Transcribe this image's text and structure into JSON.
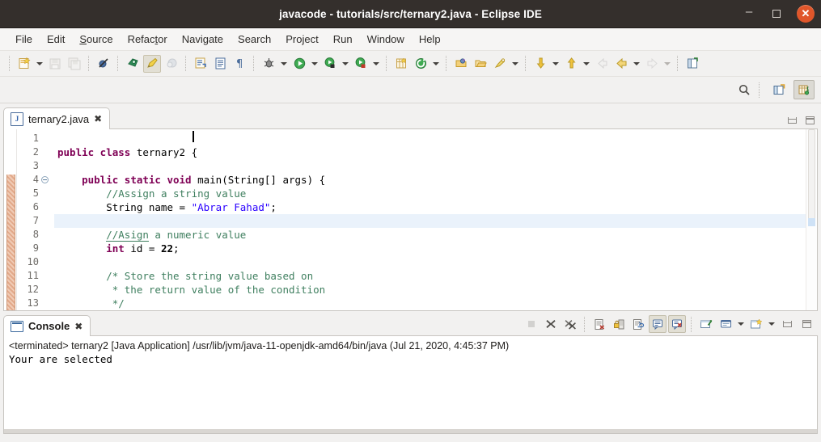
{
  "window": {
    "title": "javacode - tutorials/src/ternary2.java - Eclipse IDE",
    "minimize_label": "–",
    "maximize_label": "",
    "close_label": "✕"
  },
  "menubar": {
    "items": [
      {
        "label": "File",
        "mnemonic": ""
      },
      {
        "label": "Edit",
        "mnemonic": ""
      },
      {
        "label": "Source",
        "mnemonic": "S"
      },
      {
        "label": "Refactor",
        "mnemonic": "t"
      },
      {
        "label": "Navigate",
        "mnemonic": ""
      },
      {
        "label": "Search",
        "mnemonic": ""
      },
      {
        "label": "Project",
        "mnemonic": ""
      },
      {
        "label": "Run",
        "mnemonic": ""
      },
      {
        "label": "Window",
        "mnemonic": ""
      },
      {
        "label": "Help",
        "mnemonic": ""
      }
    ]
  },
  "toolbar": {
    "items": [
      {
        "name": "new-wizard",
        "tooltip": "New"
      },
      {
        "name": "new-dropdown",
        "tooltip": "New menu"
      },
      {
        "name": "save",
        "tooltip": "Save",
        "disabled": true
      },
      {
        "name": "save-all",
        "tooltip": "Save All",
        "disabled": true
      },
      {
        "name": "link-with-editor",
        "tooltip": "Toggle Mark Occurrences"
      },
      {
        "name": "skip-breakpoints",
        "tooltip": "Skip All Breakpoints"
      },
      {
        "name": "toggle-mark-occurrences",
        "tooltip": "Toggle Mark Occurrences",
        "pressed": true
      },
      {
        "name": "coverage",
        "tooltip": "Coverage",
        "disabled": true
      },
      {
        "name": "new-java-class",
        "tooltip": "New Java Class"
      },
      {
        "name": "open-type",
        "tooltip": "Open Type"
      },
      {
        "name": "toggle-whitespace",
        "tooltip": "Show Whitespace Characters"
      },
      {
        "name": "debug",
        "tooltip": "Debug"
      },
      {
        "name": "debug-dropdown",
        "tooltip": "Debug menu"
      },
      {
        "name": "run",
        "tooltip": "Run"
      },
      {
        "name": "run-dropdown",
        "tooltip": "Run menu"
      },
      {
        "name": "coverage-run",
        "tooltip": "Coverage As"
      },
      {
        "name": "coverage-dropdown",
        "tooltip": "Coverage menu"
      },
      {
        "name": "external-tools",
        "tooltip": "External Tools"
      },
      {
        "name": "external-tools-dropdown",
        "tooltip": "External Tools menu"
      },
      {
        "name": "new-java-project",
        "tooltip": "New Java Project"
      },
      {
        "name": "search-type",
        "tooltip": "Search"
      },
      {
        "name": "search-dropdown",
        "tooltip": "Search menu"
      },
      {
        "name": "open-package",
        "tooltip": "Open Task"
      },
      {
        "name": "open-folder",
        "tooltip": "Open Resource"
      },
      {
        "name": "quick-fix",
        "tooltip": "Quick Access"
      },
      {
        "name": "quick-fix-dropdown",
        "tooltip": "Quick Access menu"
      },
      {
        "name": "previous-annotation",
        "tooltip": "Previous Annotation"
      },
      {
        "name": "previous-dropdown",
        "tooltip": "Previous menu"
      },
      {
        "name": "next-annotation",
        "tooltip": "Next Annotation"
      },
      {
        "name": "next-dropdown",
        "tooltip": "Next menu"
      },
      {
        "name": "back",
        "tooltip": "Back",
        "disabled": true
      },
      {
        "name": "back-history",
        "tooltip": "Back History"
      },
      {
        "name": "back-history-dropdown",
        "tooltip": "Back History menu"
      },
      {
        "name": "forward",
        "tooltip": "Forward",
        "disabled": true
      },
      {
        "name": "forward-dropdown",
        "tooltip": "Forward menu",
        "disabled": true
      },
      {
        "name": "open-perspective-last",
        "tooltip": "Open Perspective"
      }
    ]
  },
  "toolbar2": {
    "quick_access_icon": "search-icon",
    "open_perspective_icon": "open-perspective-icon",
    "active_perspective": "Java",
    "active_perspective_icon": "java-perspective-icon"
  },
  "editor": {
    "tab": {
      "label": "ternary2.java",
      "icon": "java-file-icon",
      "close_label": "✖"
    },
    "minimize_tooltip": "Minimize",
    "maximize_tooltip": "Maximize",
    "lines": [
      {
        "num": "1",
        "tokens": []
      },
      {
        "num": "2",
        "tokens": [
          {
            "t": "public class",
            "c": "kw"
          },
          {
            "t": " ternary2 {",
            "c": "plain"
          }
        ]
      },
      {
        "num": "3",
        "tokens": []
      },
      {
        "num": "4",
        "fold": true,
        "tokens": [
          {
            "t": "    ",
            "c": "plain"
          },
          {
            "t": "public static void",
            "c": "kw"
          },
          {
            "t": " main(String[] args) {",
            "c": "plain"
          }
        ]
      },
      {
        "num": "5",
        "tokens": [
          {
            "t": "        ",
            "c": "plain"
          },
          {
            "t": "//Assign a string value",
            "c": "cmt"
          }
        ]
      },
      {
        "num": "6",
        "tokens": [
          {
            "t": "        String name = ",
            "c": "plain"
          },
          {
            "t": "\"Abrar Fahad\"",
            "c": "str"
          },
          {
            "t": ";",
            "c": "plain"
          }
        ]
      },
      {
        "num": "7",
        "current": true,
        "tokens": []
      },
      {
        "num": "8",
        "tokens": [
          {
            "t": "        ",
            "c": "plain"
          },
          {
            "t": "//Asign",
            "c": "typo"
          },
          {
            "t": " a numeric value",
            "c": "cmt"
          }
        ]
      },
      {
        "num": "9",
        "tokens": [
          {
            "t": "        ",
            "c": "plain"
          },
          {
            "t": "int",
            "c": "kw"
          },
          {
            "t": " id = ",
            "c": "plain"
          },
          {
            "t": "22",
            "c": "num"
          },
          {
            "t": ";",
            "c": "plain"
          }
        ]
      },
      {
        "num": "10",
        "tokens": []
      },
      {
        "num": "11",
        "tokens": [
          {
            "t": "        ",
            "c": "plain"
          },
          {
            "t": "/* Store the string value based on",
            "c": "cmt"
          }
        ]
      },
      {
        "num": "12",
        "tokens": [
          {
            "t": "         ",
            "c": "plain"
          },
          {
            "t": "* the return value of the condition",
            "c": "cmt"
          }
        ]
      },
      {
        "num": "13",
        "tokens": [
          {
            "t": "         ",
            "c": "plain"
          },
          {
            "t": "*/",
            "c": "cmt"
          }
        ]
      }
    ]
  },
  "console": {
    "tab": {
      "label": "Console",
      "icon": "console-icon",
      "close_label": "✖"
    },
    "toolbar": [
      {
        "name": "terminate",
        "tooltip": "Terminate",
        "disabled": true
      },
      {
        "name": "remove-launch",
        "tooltip": "Remove Launch"
      },
      {
        "name": "remove-all-terminated",
        "tooltip": "Remove All Terminated Launches"
      },
      {
        "name": "clear-console",
        "tooltip": "Clear Console"
      },
      {
        "name": "scroll-lock",
        "tooltip": "Scroll Lock"
      },
      {
        "name": "word-wrap",
        "tooltip": "Word Wrap"
      },
      {
        "name": "show-console-on-output",
        "tooltip": "Show Console When Standard Out Changes",
        "pressed": true
      },
      {
        "name": "show-console-on-error",
        "tooltip": "Show Console When Standard Error Changes",
        "pressed": true
      },
      {
        "name": "pin-console",
        "tooltip": "Pin Console"
      },
      {
        "name": "display-selected-console",
        "tooltip": "Display Selected Console"
      },
      {
        "name": "display-selected-console-dropdown",
        "tooltip": "Display Selected Console menu"
      },
      {
        "name": "open-console",
        "tooltip": "Open Console"
      },
      {
        "name": "open-console-dropdown",
        "tooltip": "Open Console menu"
      },
      {
        "name": "minimize",
        "tooltip": "Minimize"
      },
      {
        "name": "maximize",
        "tooltip": "Maximize"
      }
    ],
    "launch_line": "<terminated> ternary2 [Java Application] /usr/lib/jvm/java-11-openjdk-amd64/bin/java (Jul 21, 2020, 4:45:37 PM)",
    "output": "Your are selected"
  },
  "colors": {
    "titlebar_bg": "#342f2c",
    "close_button": "#e0562a",
    "chrome_bg": "#f2f1f0",
    "editor_bg": "#ffffff",
    "current_line": "#eaf2fb",
    "keyword": "#7f0055",
    "string": "#2a00ff",
    "comment": "#3f7f5f",
    "change_bar": "#e2a98a"
  }
}
